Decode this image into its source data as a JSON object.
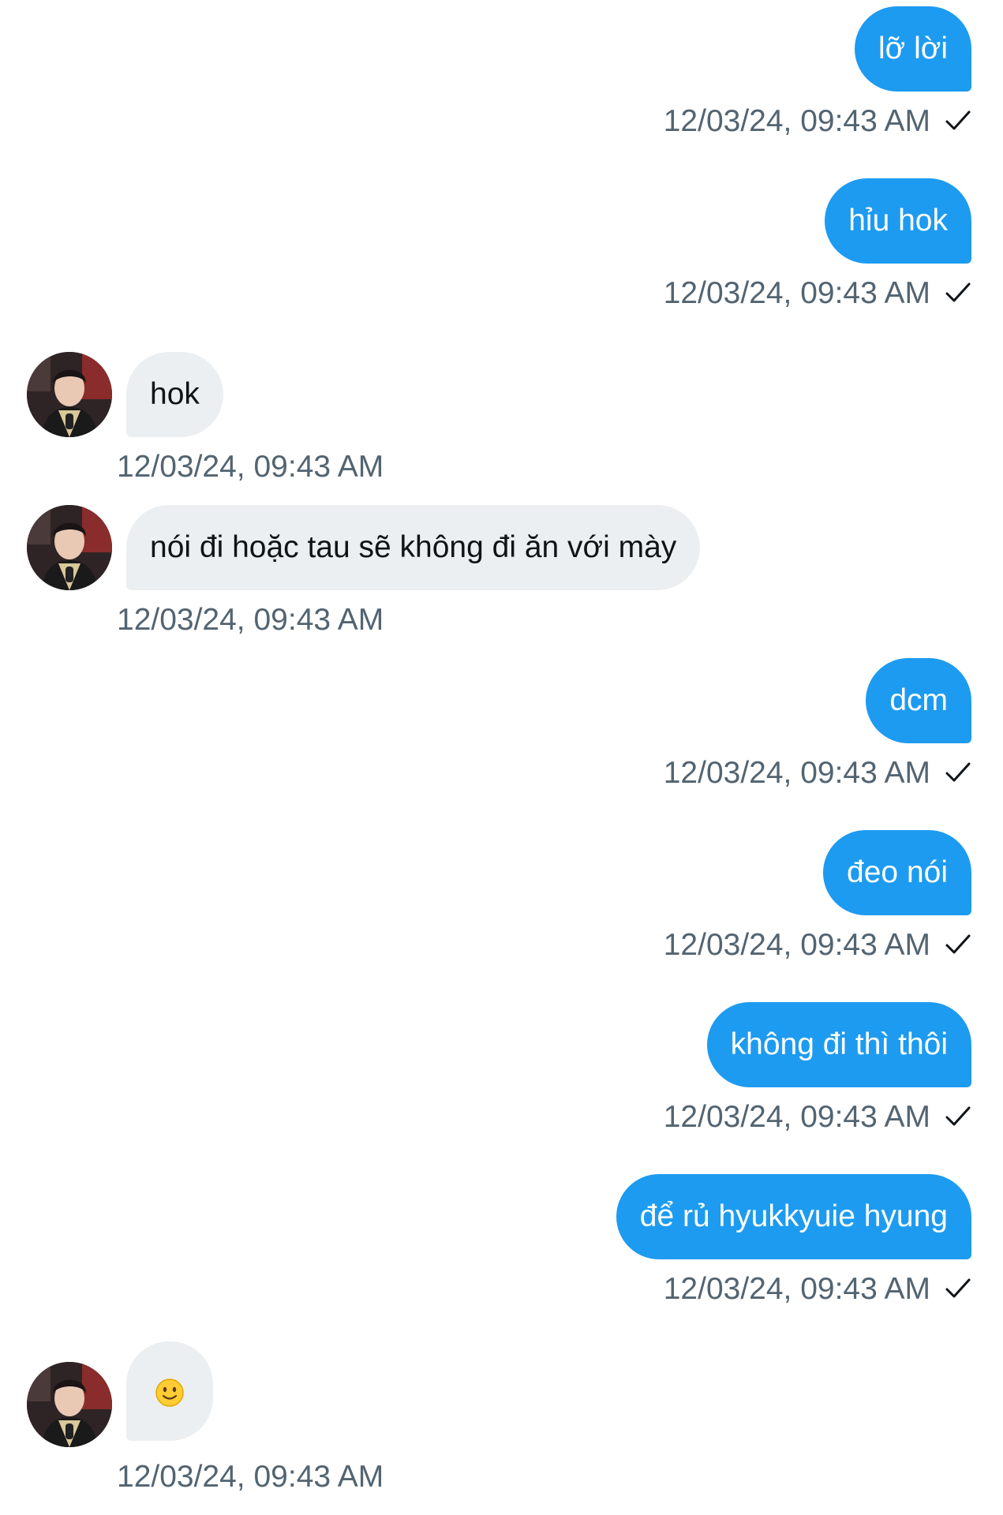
{
  "messages": [
    {
      "direction": "out",
      "text": "lỡ lời",
      "time": "12/03/24, 09:43 AM",
      "status_icon": "check-icon"
    },
    {
      "direction": "out",
      "text": "hỉu hok",
      "time": "12/03/24, 09:43 AM",
      "status_icon": "check-icon"
    },
    {
      "direction": "in",
      "text": "hok",
      "time": "12/03/24, 09:43 AM",
      "avatar": "avatar"
    },
    {
      "direction": "in",
      "text": "nói đi hoặc tau sẽ không đi ăn với mày",
      "time": "12/03/24, 09:43 AM",
      "avatar": "avatar"
    },
    {
      "direction": "out",
      "text": "dcm",
      "time": "12/03/24, 09:43 AM",
      "status_icon": "check-icon"
    },
    {
      "direction": "out",
      "text": "đeo nói",
      "time": "12/03/24, 09:43 AM",
      "status_icon": "check-icon"
    },
    {
      "direction": "out",
      "text": "không đi thì thôi",
      "time": "12/03/24, 09:43 AM",
      "status_icon": "check-icon"
    },
    {
      "direction": "out",
      "text": "để rủ hyukkyuie hyung",
      "time": "12/03/24, 09:43 AM",
      "status_icon": "check-icon"
    },
    {
      "direction": "in",
      "emoji": "slightly-smiling-face-icon",
      "time": "12/03/24, 09:43 AM",
      "avatar": "avatar"
    }
  ],
  "colors": {
    "outgoing_bubble": "#1d9bf0",
    "incoming_bubble": "#eceff1",
    "timestamp": "#536471"
  }
}
